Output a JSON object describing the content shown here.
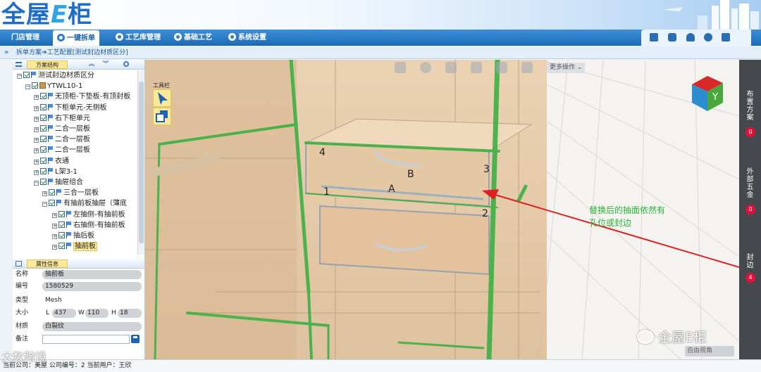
{
  "app": {
    "logo_text": "全屋E柜"
  },
  "nav": {
    "tabs": [
      {
        "label": "门店管理"
      },
      {
        "label": "一键拆单"
      },
      {
        "label": "工艺库管理"
      },
      {
        "label": "基础工艺"
      },
      {
        "label": "系统设置"
      }
    ],
    "active_index": 1,
    "tools": [
      "save-icon",
      "calendar-icon",
      "user-icon",
      "gear-icon",
      "logout-icon"
    ]
  },
  "breadcrumb": {
    "toggle": "»",
    "part1": "拆单方案",
    "part2": "工艺配置[测试封边材质区分]"
  },
  "left_panel": {
    "tree_title": "方案结构",
    "tree": [
      {
        "label": "测试封边材质区分",
        "level": 0,
        "toggle": "⊟",
        "icon": "flag"
      },
      {
        "label": "YTWL10-1",
        "level": 1,
        "toggle": "⊟",
        "icon": "box"
      },
      {
        "label": "无顶柜-下垫板-有顶封板",
        "level": 2,
        "toggle": "⊞",
        "icon": "flag"
      },
      {
        "label": "下柜单元-无侧板",
        "level": 2,
        "toggle": "⊞",
        "icon": "flag"
      },
      {
        "label": "右下柜单元",
        "level": 2,
        "toggle": "⊞",
        "icon": "flag"
      },
      {
        "label": "二合一层板",
        "level": 2,
        "toggle": "⊞",
        "icon": "flag"
      },
      {
        "label": "二合一层板",
        "level": 2,
        "toggle": "⊞",
        "icon": "flag"
      },
      {
        "label": "二合一层板",
        "level": 2,
        "toggle": "⊞",
        "icon": "flag"
      },
      {
        "label": "衣通",
        "level": 2,
        "toggle": "⊞",
        "icon": "flag"
      },
      {
        "label": "L架3-1",
        "level": 2,
        "toggle": "⊞",
        "icon": "flag"
      },
      {
        "label": "抽屉组合",
        "level": 2,
        "toggle": "⊟",
        "icon": "flag"
      },
      {
        "label": "三合一层板",
        "level": 3,
        "toggle": "⊞",
        "icon": "flag"
      },
      {
        "label": "有抽前板抽屉（薄底",
        "level": 3,
        "toggle": "⊟",
        "icon": "flag"
      },
      {
        "label": "左抽侧-有抽前板",
        "level": 4,
        "toggle": "⊞",
        "icon": "flag"
      },
      {
        "label": "右抽侧-有抽前板",
        "level": 4,
        "toggle": "⊞",
        "icon": "flag"
      },
      {
        "label": "抽后板",
        "level": 4,
        "toggle": "⊞",
        "icon": "flag"
      },
      {
        "label": "抽前板",
        "level": 4,
        "toggle": "⊞",
        "icon": "flag",
        "selected": true
      }
    ],
    "props_title": "属性信息",
    "props": {
      "name_label": "名称",
      "name": "抽前板",
      "code_label": "编号",
      "code": "1580529",
      "type_label": "类型",
      "type": "Mesh",
      "size_label": "大小",
      "L_label": "L",
      "L": "437",
      "W_label": "W",
      "W": "110",
      "H_label": "H",
      "H": "18",
      "material_label": "材质",
      "material": "白裂纹",
      "note_label": "备注",
      "note": ""
    }
  },
  "viewport": {
    "toolbar_icons": [
      "box-icon",
      "target-icon",
      "cube-icon",
      "layers-icon",
      "fullscreen-icon",
      "flash-icon"
    ],
    "more_ops": "更多操作",
    "toolbox_title": "工具栏",
    "view_cube_label": "Y",
    "view_mode": "自由视角",
    "markers": [
      "4",
      "B",
      "3",
      "1",
      "A",
      "2"
    ],
    "annotation_line1": "替换后的抽面依然有",
    "annotation_line2": "孔位或封边",
    "watermark": "全屋E柜"
  },
  "right_bar": {
    "items": [
      {
        "label": "布\n置\n方\n案",
        "count": "0"
      },
      {
        "label": "外\n部\n五\n金",
        "count": "0"
      },
      {
        "label": "封\n边",
        "count": "4"
      }
    ]
  },
  "status_bar": {
    "text": "当前公司：美屋   公司编号：2     当前用户：王欣"
  },
  "overlay_watermark": "大数跨境"
}
